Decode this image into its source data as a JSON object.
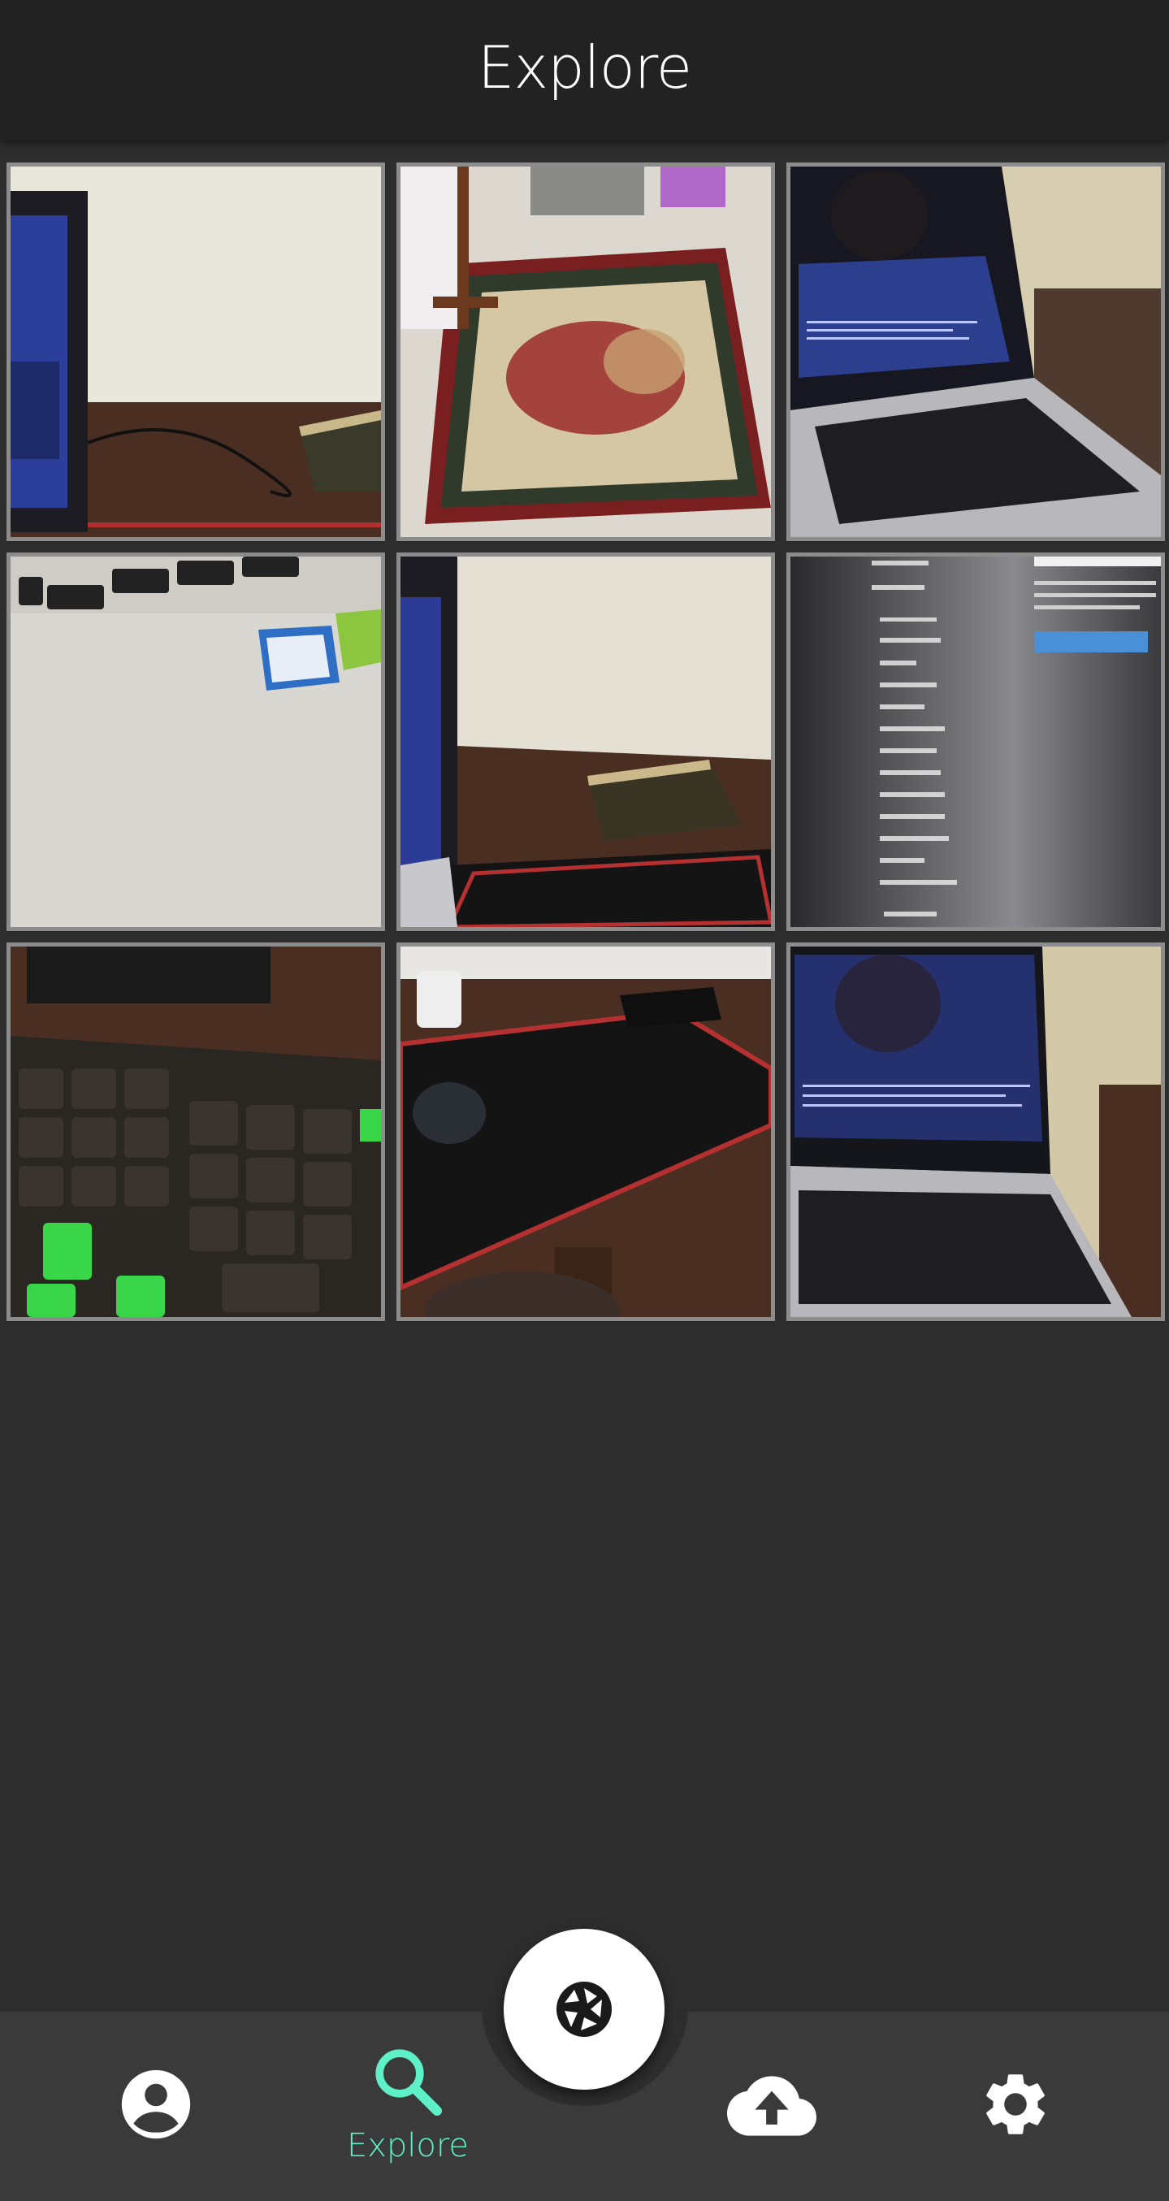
{
  "header": {
    "title": "Explore"
  },
  "gallery": {
    "photos": [
      {
        "icon": "photo-laptop-desk-book"
      },
      {
        "icon": "photo-rug-chair"
      },
      {
        "icon": "photo-laptop-code"
      },
      {
        "icon": "photo-laptop-stickers"
      },
      {
        "icon": "photo-desk-book-mousepad"
      },
      {
        "icon": "photo-settings-screen"
      },
      {
        "icon": "photo-keyboard-numpad"
      },
      {
        "icon": "photo-mousepad-mouse"
      },
      {
        "icon": "photo-laptop-screen"
      }
    ]
  },
  "nav": {
    "profile": {
      "icon": "account-circle-icon"
    },
    "explore": {
      "icon": "search-icon",
      "label": "Explore",
      "active": true
    },
    "capture": {
      "icon": "camera-shutter-icon"
    },
    "upload": {
      "icon": "cloud-upload-icon"
    },
    "settings": {
      "icon": "gear-icon"
    }
  },
  "colors": {
    "accent": "#5ef0c6",
    "header_bg": "#222222",
    "body_bg": "#2d2d2d",
    "nav_bg": "#3a3a3a"
  }
}
